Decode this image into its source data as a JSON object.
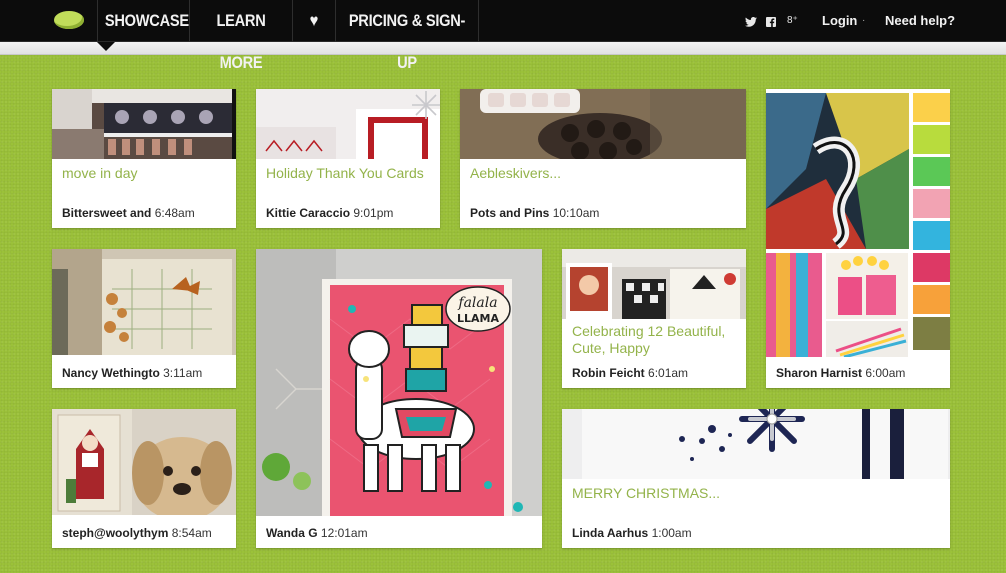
{
  "nav": {
    "showcase": "SHOWCASE",
    "learn_more": "LEARN MORE",
    "heart": "♥",
    "pricing": "PRICING & SIGN-UP",
    "social": {
      "twitter": "🐦",
      "facebook": "f",
      "google": "8⁺"
    },
    "login": "Login",
    "separator": "·",
    "help": "Need help?"
  },
  "colors": {
    "background": "#9bc13a",
    "title_green": "#93b34a",
    "topbar": "#0c0c0c"
  },
  "cards": [
    {
      "id": "c1",
      "title": "move in day",
      "author": "Bittersweet and",
      "time": "6:48am"
    },
    {
      "id": "c2",
      "title": "Holiday Thank You Cards",
      "author": "Kittie Caraccio",
      "time": "9:01pm"
    },
    {
      "id": "c3",
      "title": "Aebleskivers...",
      "author": "Pots and Pins",
      "time": "10:10am"
    },
    {
      "id": "c4",
      "title": "",
      "author": "Sharon Harnist",
      "time": "6:00am"
    },
    {
      "id": "c5",
      "title": "",
      "author": "Nancy Wethingto",
      "time": "3:11am"
    },
    {
      "id": "c6",
      "title": "",
      "author": "Wanda G",
      "time": "12:01am",
      "image_text": [
        "falala",
        "LLAMA"
      ]
    },
    {
      "id": "c7",
      "title": "Celebrating 12 Beautiful, Cute, Happy",
      "author": "Robin Feicht",
      "time": "6:01am"
    },
    {
      "id": "c8",
      "title": "",
      "author": "steph@woolythym",
      "time": "8:54am"
    },
    {
      "id": "c9",
      "title": "MERRY CHRISTMAS...",
      "author": "Linda Aarhus",
      "time": "1:00am"
    }
  ]
}
